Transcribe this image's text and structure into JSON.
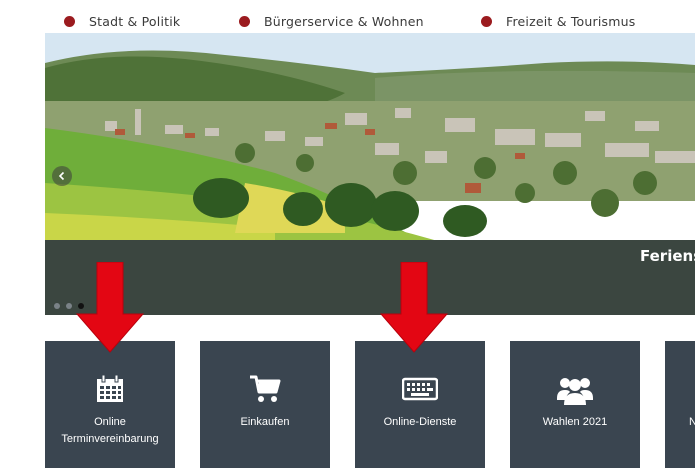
{
  "nav": {
    "items": [
      {
        "label": "Stadt & Politik"
      },
      {
        "label": "Bürgerservice & Wohnen"
      },
      {
        "label": "Freizeit & Tourismus"
      }
    ],
    "dot_color": "#9b1b1f"
  },
  "slider": {
    "caption": "Feriens",
    "dots_count": 3,
    "active_dot": 3
  },
  "tiles": [
    {
      "label_line1": "Online",
      "label_line2": "Terminvereinbarung",
      "icon": "calendar-icon"
    },
    {
      "label_line1": "Einkaufen",
      "label_line2": "",
      "icon": "shopping-cart-icon"
    },
    {
      "label_line1": "Online-Dienste",
      "label_line2": "",
      "icon": "keyboard-icon"
    },
    {
      "label_line1": "Wahlen 2021",
      "label_line2": "",
      "icon": "group-icon"
    },
    {
      "label_line1": "N",
      "label_line2": "",
      "icon": "unknown-icon"
    }
  ],
  "colors": {
    "tile_bg": "#3a4550",
    "caption_band": "#343c3e",
    "annotation_arrow": "#e30613"
  }
}
